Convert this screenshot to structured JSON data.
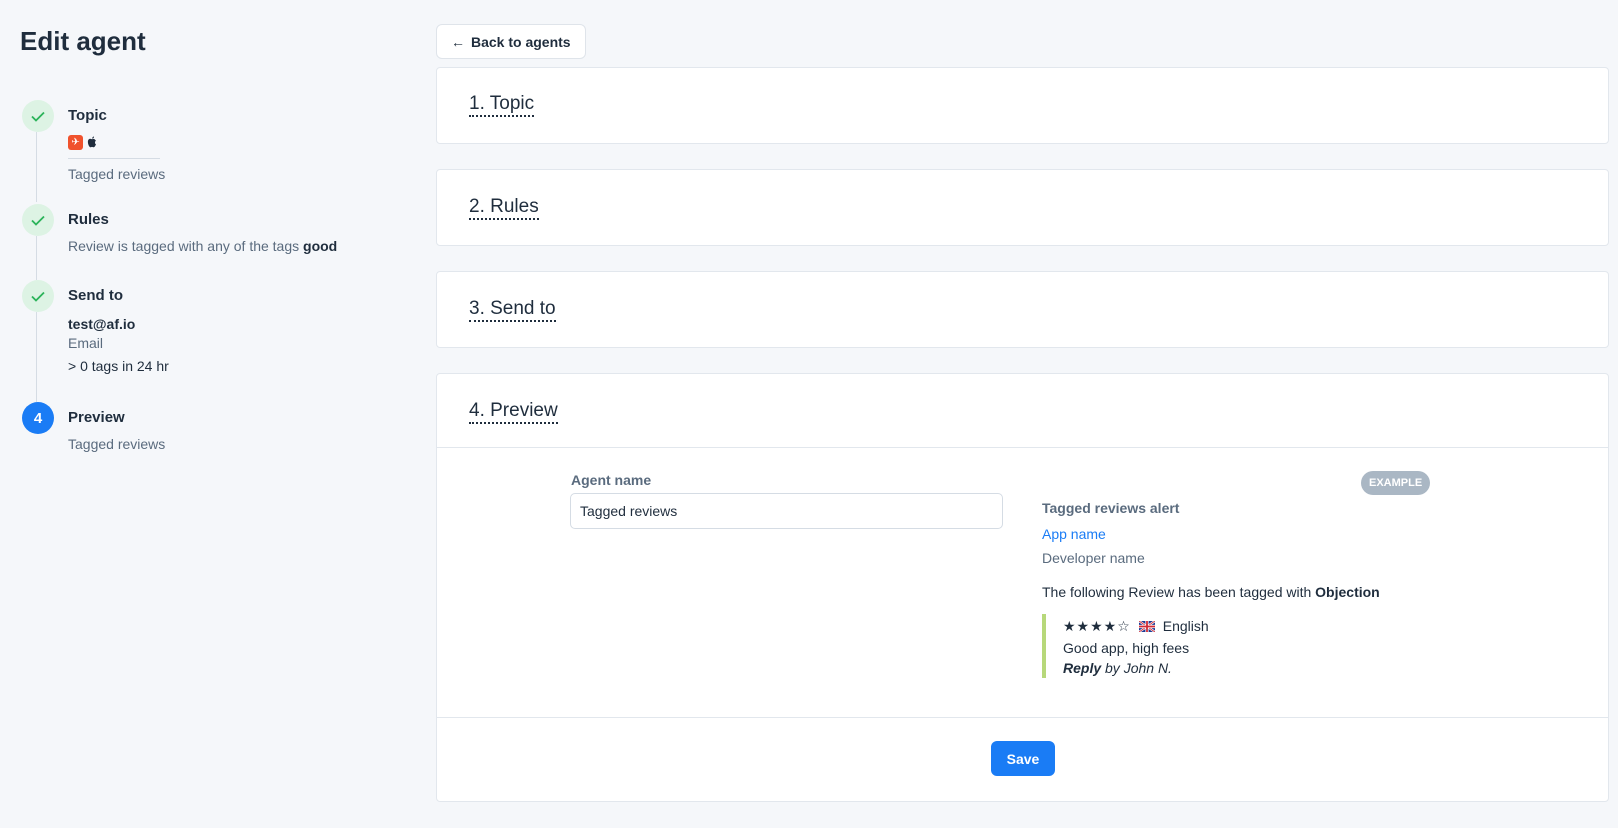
{
  "page": {
    "title": "Edit agent"
  },
  "steps": {
    "topic": {
      "title": "Topic",
      "subtitle": "Tagged reviews"
    },
    "rules": {
      "title": "Rules",
      "text": "Review is tagged with any of the tags",
      "tag": "good"
    },
    "send_to": {
      "title": "Send to",
      "recipient": "test@af.io",
      "channel": "Email",
      "condition": "> 0 tags in 24 hr"
    },
    "preview": {
      "number": "4",
      "title": "Preview",
      "subtitle": "Tagged reviews"
    }
  },
  "toolbar": {
    "back_label": "Back to agents",
    "back_arrow": "←"
  },
  "sections": {
    "topic": "1. Topic",
    "rules": "2. Rules",
    "send_to": "3. Send to",
    "preview": "4. Preview"
  },
  "preview": {
    "field_label": "Agent name",
    "agent_name_value": "Tagged reviews",
    "example_badge": "EXAMPLE",
    "alert_title": "Tagged reviews alert",
    "app_name": "App name",
    "developer_name": "Developer name",
    "tag_message": "The following Review has been tagged with",
    "tag_name": "Objection",
    "review": {
      "stars": "★★★★☆",
      "rating": 4,
      "max_rating": 5,
      "language": "English",
      "text": "Good app, high fees",
      "reply_label": "Reply",
      "reply_by": "by John N."
    },
    "save_label": "Save"
  },
  "colors": {
    "accent": "#1a7cf5",
    "success_bg": "#ddf3e4",
    "success_check": "#2bb35a",
    "review_border": "#b7d87a",
    "app_badge": "#f0522d"
  }
}
